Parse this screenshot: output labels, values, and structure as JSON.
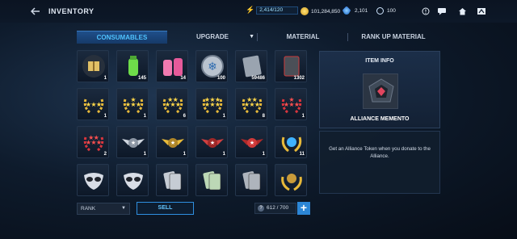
{
  "header": {
    "title": "INVENTORY",
    "energy": "2,414/120",
    "gold": "101,284,850",
    "crystals": "2,101",
    "timer_count": "100"
  },
  "tabs": [
    {
      "label": "CONSUMABLES",
      "active": true
    },
    {
      "label": "UPGRADE",
      "active": false
    },
    {
      "label": "MATERIAL",
      "active": false
    },
    {
      "label": "RANK UP MATERIAL",
      "active": false
    }
  ],
  "items": [
    {
      "icon": "gift-box-icon",
      "qty": "1"
    },
    {
      "icon": "green-bottle-icon",
      "qty": "145"
    },
    {
      "icon": "pink-bottles-icon",
      "qty": "14"
    },
    {
      "icon": "snowflake-coin-icon",
      "qty": "100"
    },
    {
      "icon": "gray-card-icon",
      "qty": "59486"
    },
    {
      "icon": "dark-card-icon",
      "qty": "1302"
    },
    {
      "icon": "three-gold-stars-wreath-icon",
      "qty": "1"
    },
    {
      "icon": "four-gold-stars-wreath-icon",
      "qty": "1"
    },
    {
      "icon": "five-gold-stars-wreath-icon",
      "qty": "6"
    },
    {
      "icon": "six-gold-stars-wreath-icon",
      "qty": "1"
    },
    {
      "icon": "seven-gold-stars-wreath-icon",
      "qty": "8"
    },
    {
      "icon": "three-red-stars-wreath-icon",
      "qty": "1"
    },
    {
      "icon": "red-stars-wreath-icon",
      "qty": "2"
    },
    {
      "icon": "winged-silver-badge-icon",
      "qty": "1"
    },
    {
      "icon": "winged-gold-badge-icon",
      "qty": "1"
    },
    {
      "icon": "winged-red-badge-icon",
      "qty": "1"
    },
    {
      "icon": "red-stars-winged-badge-icon",
      "qty": "1"
    },
    {
      "icon": "blue-gem-wreath-icon",
      "qty": "11"
    },
    {
      "icon": "mask-emblem-icon",
      "qty": ""
    },
    {
      "icon": "mask-emblem-icon",
      "qty": ""
    },
    {
      "icon": "ticket-cards-icon",
      "qty": ""
    },
    {
      "icon": "green-ticket-cards-icon",
      "qty": ""
    },
    {
      "icon": "gray-ticket-cards-icon",
      "qty": ""
    },
    {
      "icon": "gold-crest-icon",
      "qty": ""
    }
  ],
  "info": {
    "title": "ITEM INFO",
    "name": "ALLIANCE MEMENTO",
    "description": "Get an Alliance Token when you donate to the Alliance."
  },
  "footer": {
    "sort_label": "RANK",
    "sell_label": "SELL",
    "capacity": "612 / 700"
  },
  "colors": {
    "accent": "#2c86d6",
    "tab_active_text": "#4fc3ff",
    "background": "#0e1b2c"
  }
}
